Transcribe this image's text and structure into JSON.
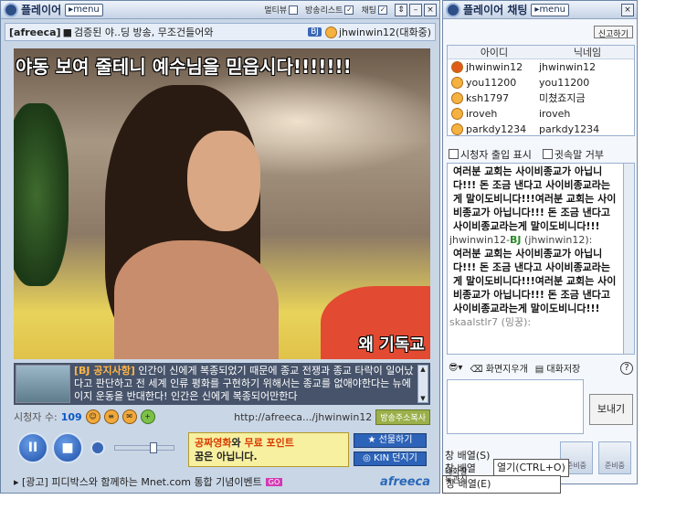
{
  "player": {
    "title": "플레이어",
    "menu": "▸menu",
    "toggles": [
      {
        "label": "멀티뷰",
        "checked": false
      },
      {
        "label": "방송리스트",
        "checked": true
      },
      {
        "label": "채팅",
        "checked": true
      }
    ],
    "info": {
      "tag": "[afreeca]",
      "marker": "■",
      "title": "검증된 야..딩 방송, 무조건들어와",
      "bj": "BJ",
      "bj_name": "jhwinwin12(대화중)"
    },
    "video": {
      "caption_top": "야동 보여 줄테니 예수님을 믿읍시다!!!!!!!",
      "caption_bottom": "왜 기독교"
    },
    "notice": {
      "label": "[BJ 공지사항]",
      "text": "인간이 신에게 복종되었기 때문에 종교 전쟁과 종교 타락이 일어났다고 판단하고 전 세계 인류 평화를 구현하기 위해서는 종교를 없애야한다는 뉴에이지 운동을 반대한다! 인간은 신에게 복종되어만한다"
    },
    "status": {
      "viewers_label": "시청자 수:",
      "viewers": "109",
      "url": "http://afreeca.../jhwinwin12",
      "copy": "방송주소복사"
    },
    "controls": {
      "pause": "II",
      "stop": "■"
    },
    "ad": {
      "line1a": "공짜영화",
      "line1b": "와",
      "line1c": "무료 포인트",
      "line2": "꿈은 아닙니다."
    },
    "side_buttons": [
      "★ 선물하기",
      "◎ KIN 던지기"
    ],
    "bottom_ad": {
      "text": "▸ [광고] 피디박스와 함께하는 Mnet.com 통합 기념이벤트",
      "go": "GO",
      "brand": "afreeca"
    }
  },
  "chat": {
    "title": "플레이어 채팅",
    "menu": "▸menu",
    "report": "신고하기",
    "columns": [
      "아이디",
      "닉네임"
    ],
    "users": [
      {
        "id": "jhwinwin12",
        "nick": "jhwinwin12"
      },
      {
        "id": "you11200",
        "nick": "you11200"
      },
      {
        "id": "ksh1797",
        "nick": "미쳤죠지금"
      },
      {
        "id": "iroveh",
        "nick": "iroveh"
      },
      {
        "id": "parkdy1234",
        "nick": "parkdy1234"
      }
    ],
    "options": [
      "시청자 출입 표시",
      "귓속말 거부"
    ],
    "log": {
      "msg1": "여러분 교회는 사이비종교가 아닙니다!!! 돈 조금 낸다고 사이비종교라는게 말이도비니다!!!여러분 교회는 사이비종교가 아닙니다!!! 돈 조금 낸다고 사이비종교라는게 말이도비니다!!!",
      "user": "jhwinwin12-",
      "role": "BJ",
      "user_suffix": " (jhwinwin12):",
      "msg2": "여러분 교회는 사이비종교가 아닙니다!!! 돈 조금 낸다고 사이비종교라는게 말이도비니다!!!여러분 교회는 사이비종교가 아닙니다!!! 돈 조금 낸다고 사이비종교라는게 말이도비니다!!!",
      "next_user": "skaalstlr7 (밍꿍):"
    },
    "tools": [
      "화면지우개",
      "대화저장"
    ],
    "help": "?",
    "send": "보내기",
    "emotes": [
      "준비중",
      "준비중"
    ]
  },
  "context_menu": {
    "items": [
      "창 배열(S)",
      "열기(CTRL+O)",
      "창 배열",
      "창 배열(E)"
    ],
    "partial": [
      "대화창",
      "독관식"
    ]
  }
}
